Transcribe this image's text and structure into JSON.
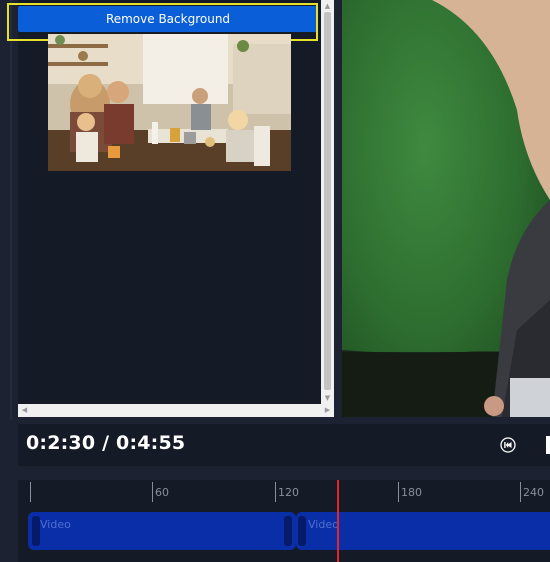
{
  "toolbar": {
    "remove_background_label": "Remove Background"
  },
  "playback": {
    "timecode": "0:2:30 / 0:4:55"
  },
  "timeline": {
    "ticks": [
      "60",
      "120",
      "180",
      "240"
    ],
    "clips": [
      {
        "label": "Video"
      },
      {
        "label": "Video"
      }
    ]
  },
  "icons": {
    "rewind": "rewind-icon",
    "scroll_up": "arrow-up-icon",
    "scroll_down": "arrow-down-icon",
    "scroll_left": "arrow-left-icon",
    "scroll_right": "arrow-right-icon"
  },
  "colors": {
    "accent": "#0a5fd8",
    "highlight": "#e6e22c",
    "clip": "#0a2ea8",
    "playhead": "#e0262a",
    "greenscreen": "#2e6e2e"
  }
}
